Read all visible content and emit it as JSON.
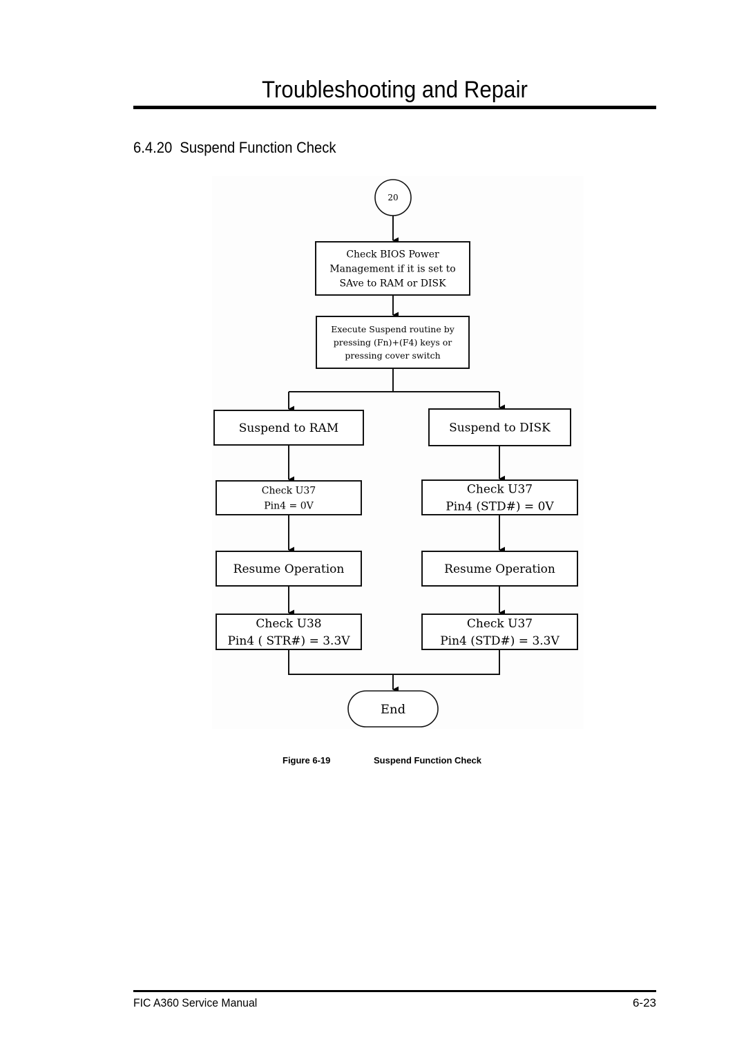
{
  "header": {
    "title": "Troubleshooting and Repair"
  },
  "section": {
    "number": "6.4.20",
    "title": "Suspend Function Check"
  },
  "flowchart": {
    "start": "20",
    "nodes": {
      "check_bios": [
        "Check BIOS Power",
        "Management if it is set to",
        "SAve to RAM or DISK"
      ],
      "execute_suspend": [
        "Execute Suspend routine by",
        "pressing (Fn)+(F4) keys or",
        "pressing cover switch"
      ],
      "suspend_ram": [
        "Suspend to RAM"
      ],
      "suspend_disk": [
        "Suspend to DISK"
      ],
      "check_u37_ram": [
        "Check U37",
        "Pin4 = 0V"
      ],
      "check_u37_disk": [
        "Check U37",
        "Pin4 (STD#) = 0V"
      ],
      "resume_ram": [
        "Resume Operation"
      ],
      "resume_disk": [
        "Resume Operation"
      ],
      "check_u38": [
        "Check U38",
        "Pin4 ( STR#) = 3.3V"
      ],
      "check_u37_std": [
        "Check U37",
        "Pin4 (STD#) = 3.3V"
      ],
      "end": [
        "End"
      ]
    }
  },
  "caption": {
    "label": "Figure 6-19",
    "title": "Suspend Function Check"
  },
  "footer": {
    "manual": "FIC A360 Service Manual",
    "page": "6-23"
  }
}
